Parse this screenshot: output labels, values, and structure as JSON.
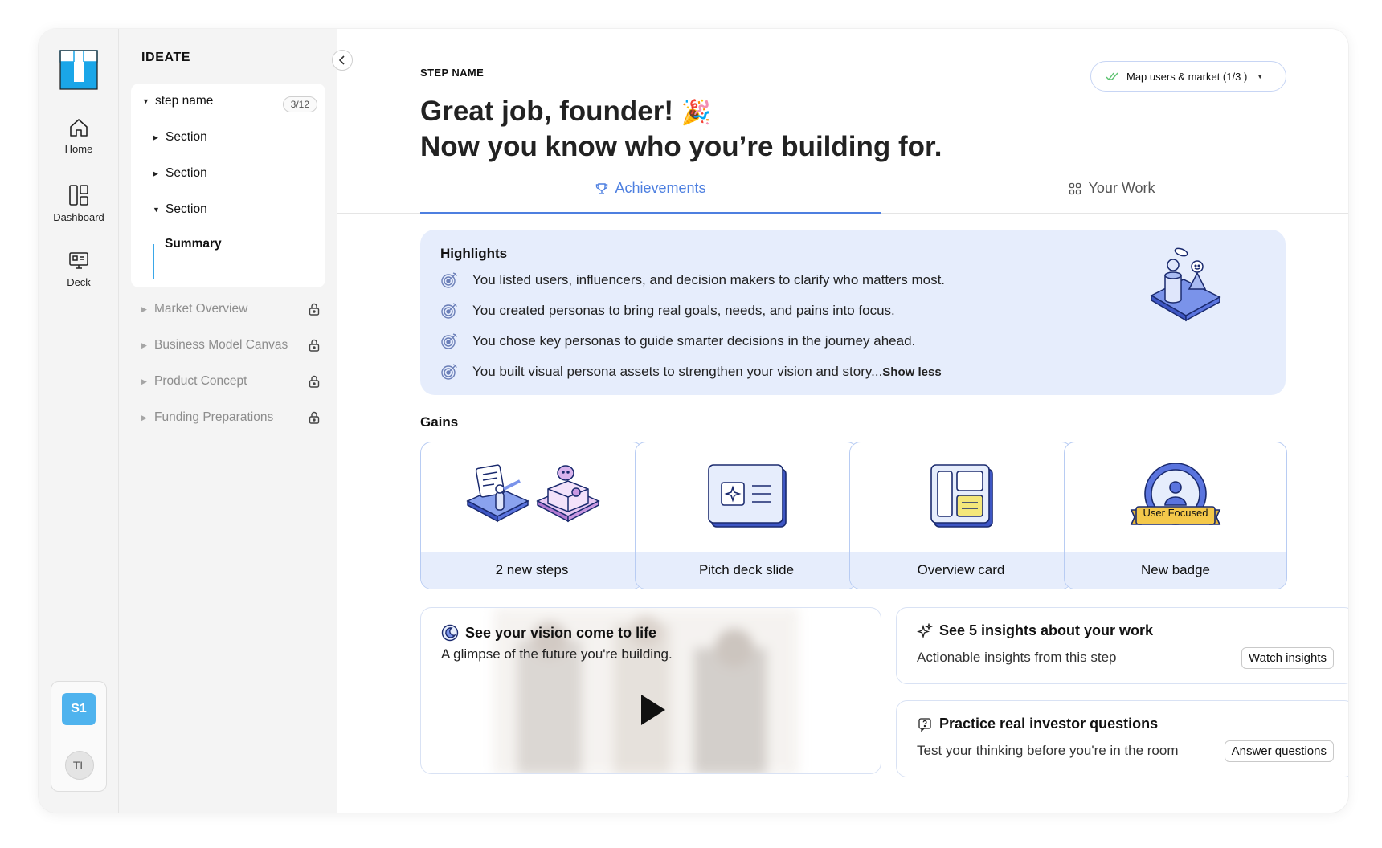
{
  "rail": {
    "items": [
      {
        "label": "Home",
        "icon": "home-icon"
      },
      {
        "label": "Dashboard",
        "icon": "dashboard-icon"
      },
      {
        "label": "Deck",
        "icon": "deck-icon"
      }
    ],
    "workspace_badge": "S1",
    "user_initials": "TL"
  },
  "sidebar": {
    "title": "IDEATE",
    "current_step": {
      "label": "step name",
      "count": "3/12"
    },
    "sections": [
      "Section",
      "Section",
      "Section"
    ],
    "active_item": "Summary",
    "locked_steps": [
      "Market Overview",
      "Business Model Canvas",
      "Product Concept",
      "Funding Preparations"
    ]
  },
  "header": {
    "step_label": "STEP NAME",
    "headline_1": "Great job, founder!",
    "headline_emoji": "🎉",
    "headline_2": "Now you know who you’re building for.",
    "progress_pill": "Map users & market (1/3 )"
  },
  "tabs": [
    {
      "label": "Achievements",
      "icon": "trophy-icon",
      "active": true
    },
    {
      "label": "Your Work",
      "icon": "grid-icon",
      "active": false
    }
  ],
  "highlights": {
    "title": "Highlights",
    "items": [
      "You listed users, influencers, and decision makers to clarify who matters most.",
      "You created personas to bring real goals, needs, and pains into focus.",
      "You chose key personas to guide smarter decisions in the journey ahead.",
      "You built visual persona assets to strengthen your vision and story..."
    ],
    "show_less": "Show less"
  },
  "gains": {
    "title": "Gains",
    "cards": [
      {
        "label": "2 new steps"
      },
      {
        "label": "Pitch deck slide"
      },
      {
        "label": "Overview card"
      },
      {
        "label": "New badge",
        "badge_text": "User Focused"
      }
    ]
  },
  "video": {
    "title": "See your vision come to life",
    "subtitle": "A glimpse of the future you're building."
  },
  "insights": {
    "title": "See 5 insights about your work",
    "subtitle": "Actionable insights from this step",
    "button": "Watch insights"
  },
  "practice": {
    "title": "Practice real investor questions",
    "subtitle": "Test your thinking before you're in the room",
    "button": "Answer questions"
  },
  "colors": {
    "accent_blue": "#4d7fe0",
    "highlight_bg": "#e6edfc",
    "logo_blue": "#1aa6e8",
    "workspace_badge": "#4fb3ee"
  }
}
